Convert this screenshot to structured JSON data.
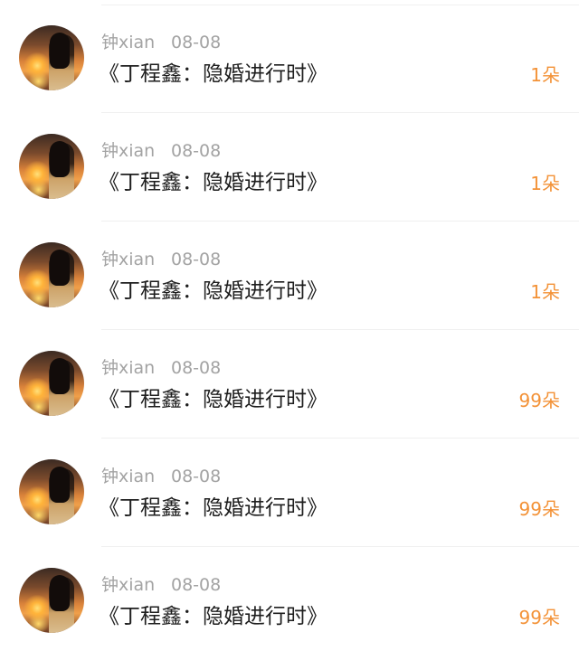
{
  "colors": {
    "count_accent": "#f39237",
    "secondary_text": "#a3a3a3",
    "primary_text": "#1e1e1e"
  },
  "items": [
    {
      "user": "钟xian",
      "date": "08-08",
      "title": "《丁程鑫：隐婚进行时》",
      "count": "1朵",
      "avatar_icon": "user-avatar-sunset-portrait"
    },
    {
      "user": "钟xian",
      "date": "08-08",
      "title": "《丁程鑫：隐婚进行时》",
      "count": "1朵",
      "avatar_icon": "user-avatar-sunset-portrait"
    },
    {
      "user": "钟xian",
      "date": "08-08",
      "title": "《丁程鑫：隐婚进行时》",
      "count": "1朵",
      "avatar_icon": "user-avatar-sunset-portrait"
    },
    {
      "user": "钟xian",
      "date": "08-08",
      "title": "《丁程鑫：隐婚进行时》",
      "count": "99朵",
      "avatar_icon": "user-avatar-sunset-portrait"
    },
    {
      "user": "钟xian",
      "date": "08-08",
      "title": "《丁程鑫：隐婚进行时》",
      "count": "99朵",
      "avatar_icon": "user-avatar-sunset-portrait"
    },
    {
      "user": "钟xian",
      "date": "08-08",
      "title": "《丁程鑫：隐婚进行时》",
      "count": "99朵",
      "avatar_icon": "user-avatar-sunset-portrait"
    }
  ]
}
